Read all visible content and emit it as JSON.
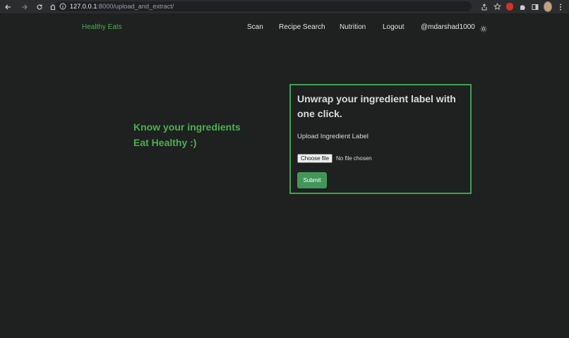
{
  "browser": {
    "url_host": "127.0.0.1",
    "url_path": ":8000/upload_and_extract/"
  },
  "site": {
    "brand": "Healthy Eats",
    "nav": {
      "scan": "Scan",
      "recipe_search": "Recipe Search",
      "nutrition": "Nutrition",
      "logout": "Logout",
      "user": "@mdarshad1000"
    }
  },
  "hero": {
    "line1": "Know your ingredients",
    "line2": "Eat Healthy :)"
  },
  "upload_card": {
    "title": "Unwrap your ingredient label with one click.",
    "label": "Upload Ingredient Label",
    "choose_file": "Choose file",
    "file_status": "No file chosen",
    "submit": "Submit"
  },
  "colors": {
    "accent": "#4caf50",
    "background": "#1e211f",
    "card_border": "#41a052",
    "button": "#41975a"
  }
}
